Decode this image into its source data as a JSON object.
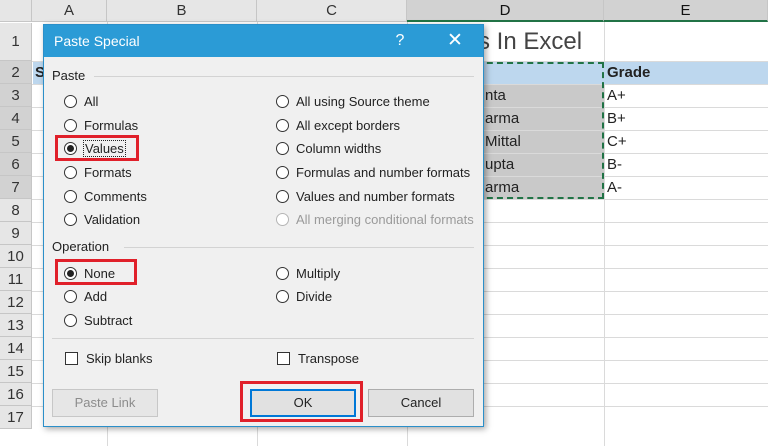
{
  "sheet": {
    "columns": [
      "A",
      "B",
      "C",
      "D",
      "E"
    ],
    "rows": [
      "1",
      "2",
      "3",
      "4",
      "5",
      "6",
      "7",
      "8",
      "9",
      "10",
      "11",
      "12",
      "13",
      "14",
      "15",
      "16",
      "17"
    ],
    "title_fragment": "s In Excel",
    "row2": {
      "a": "S",
      "e": "Grade"
    },
    "names": [
      "nta",
      "arma",
      "Mittal",
      "upta",
      "arma"
    ],
    "grades": [
      "A+",
      "B+",
      "C+",
      "B-",
      "A-"
    ]
  },
  "dialog": {
    "title": "Paste Special",
    "help": "?",
    "close": "✕",
    "paste_section": "Paste",
    "paste_options_left": [
      "All",
      "Formulas",
      "Values",
      "Formats",
      "Comments",
      "Validation"
    ],
    "paste_options_right": [
      "All using Source theme",
      "All except borders",
      "Column widths",
      "Formulas and number formats",
      "Values and number formats",
      "All merging conditional formats"
    ],
    "paste_selected": "Values",
    "operation_section": "Operation",
    "operation_left": [
      "None",
      "Add",
      "Subtract"
    ],
    "operation_right": [
      "Multiply",
      "Divide"
    ],
    "operation_selected": "None",
    "skip_blanks": "Skip blanks",
    "transpose": "Transpose",
    "paste_link_button": "Paste Link",
    "ok_button": "OK",
    "cancel_button": "Cancel"
  },
  "colors": {
    "titlebar": "#2b9bd6",
    "highlight_red": "#e0202a",
    "excel_green": "#217346",
    "header_blue": "#bdd7ee"
  }
}
